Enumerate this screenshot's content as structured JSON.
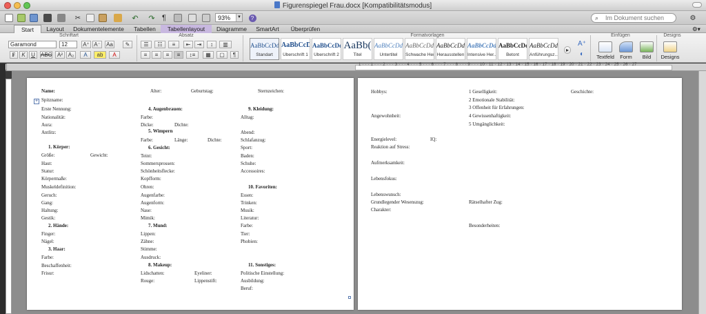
{
  "window": {
    "title": "Figurenspiegel Frau.docx [Kompatibilitätsmodus]"
  },
  "toolbar": {
    "zoom": "93%",
    "search_placeholder": "Im Dokument suchen",
    "paragraph_mark": "¶"
  },
  "tabs": [
    "Start",
    "Layout",
    "Dokumentelemente",
    "Tabellen",
    "Tabellenlayout",
    "Diagramme",
    "SmartArt",
    "Überprüfen"
  ],
  "ribbon": {
    "groups": {
      "schriftart": "Schriftart",
      "absatz": "Absatz",
      "formatvorlagen": "Formatvorlagen",
      "einfuegen": "Einfügen",
      "designs": "Designs"
    },
    "font_name": "Garamond",
    "font_size": "12",
    "styles": [
      {
        "preview": "AaBbCcDdE",
        "name": "Standart"
      },
      {
        "preview": "AaBbCcD",
        "name": "Überschrift 1"
      },
      {
        "preview": "AaBbCcDdI",
        "name": "Überschrift 2"
      },
      {
        "preview": "AaBb(",
        "name": "Titel"
      },
      {
        "preview": "AaBbCcDdE",
        "name": "Untertitel"
      },
      {
        "preview": "AaBbCcDdE",
        "name": "Schwache Her..."
      },
      {
        "preview": "AaBbCcDdEe",
        "name": "Herausstellen"
      },
      {
        "preview": "AaBbCcDdEe",
        "name": "Intensive Her..."
      },
      {
        "preview": "AaBbCcDdEe",
        "name": "Betont"
      },
      {
        "preview": "AaBbCcDdEe",
        "name": "Anführungsz..."
      }
    ],
    "insert_buttons": [
      "Textfeld",
      "Form",
      "Bild"
    ],
    "designs_button": "Designs"
  },
  "ruler": {
    "labels": "1 · · · 1 · · · 2 · · · 3 · · · 4 · · · 5 · · · 6 · · · 7 · · · 8 · · · 9 · · · 10 · 11 · 12 · 13 · 14 · 15 · 16 · 17 · 18 · 19 · 20 · 21 · 22 · 23 · 24 · 25 · 26 · 27"
  },
  "page1": {
    "col1": {
      "name": "Name:",
      "spitzname": "Spitzname:",
      "erste_nennung": "Erste Nennung:",
      "nationalitaet": "Nationalität:",
      "aura": "Aura:",
      "antlitz": "Antlitz:",
      "h1": "1.   Körper:",
      "groesse": "Größe:",
      "gewicht": "Gewicht:",
      "haut": "Haut:",
      "statur": "Statur:",
      "koerpermasse": "Körpermaße:",
      "muskel": "Muskeldefinition:",
      "geruch": "Geruch:",
      "gang": "Gang:",
      "haltung": "Haltung:",
      "gestik": "Gestik:",
      "h2": "2.   Hände:",
      "finger": "Finger:",
      "naegel": "Nägel:",
      "h3": "3.   Haar:",
      "farbe": "Farbe:",
      "beschaffenheit": "Beschaffenheit:",
      "frisur": "Frisur:"
    },
    "col2": {
      "alter": "Alter:",
      "geburtstag": "Geburtstag:",
      "h4": "4.   Augenbrauen:",
      "farbe": "Farbe:",
      "dicke": "Dicke:",
      "dichte": "Dichte:",
      "h5": "5.   Wimpern",
      "farbe2": "Farbe:",
      "laenge": "Länge:",
      "dichte2": "Dichte:",
      "h6": "6.   Gesicht:",
      "teint": "Teint:",
      "sommersprossen": "Sommersprossen:",
      "schoenheitsflecke": "Schönheitsflecke:",
      "kopfform": "Kopfform:",
      "ohren": "Ohren:",
      "augenfarbe": "Augenfarbe:",
      "augenform": "Augenform:",
      "nase": "Nase:",
      "mimik": "Mimik:",
      "h7": "7.   Mund:",
      "lippen": "Lippen:",
      "zaehne": "Zähne:",
      "stimme": "Stimme:",
      "ausdruck": "Ausdruck:",
      "h8": "8.   Makeup:",
      "lidschatten": "Lidschatten:",
      "eyeliner": "Eyeliner:",
      "rouge": "Rouge:",
      "lippenstift": "Lippenstift:"
    },
    "col3": {
      "sternzeichen": "Sternzeichen:",
      "h9": "9.   Kleidung:",
      "alltag": "Alltag:",
      "abend": "Abend:",
      "schlafanzug": "Schlafanzug:",
      "sport": "Sport:",
      "baden": "Baden:",
      "schuhe": "Schuhe:",
      "accessoires": "Accessoires:",
      "h10": "10.  Favoriten:",
      "essen": "Essen:",
      "trinken": "Trinken:",
      "musik": "Musik:",
      "literatur": "Literatur:",
      "farbe": "Farbe:",
      "tier": "Tier:",
      "phobien": "Phobien:",
      "h11": "11.  Sonstiges:",
      "politik": "Politische Einstellung:",
      "ausbildung": "Ausbildung:",
      "beruf": "Beruf:"
    }
  },
  "page2": {
    "hobbys": "Hobbys:",
    "eig1": "1 Geselligkeit:",
    "eig2": "2 Emotionale Stabilität:",
    "eig3": "3 Offenheit für Erfahrungen:",
    "eig4": "4 Gewissenhaftigkeit:",
    "eig5": "5 Umgänglichkeit:",
    "geschichte": "Geschichte:",
    "angewohnheit": "Angewohnheit:",
    "energielevel": "Energielevel:",
    "iq": "IQ:",
    "reaktion": "Reaktion auf Stress:",
    "aufmerksamkeit": "Aufmerksamkeit:",
    "lebensfokus": "Lebensfokus:",
    "lebenswunsch": "Lebenswunsch:",
    "wesenszug": "Grundlegender Wesenszug:",
    "raetsel": "Rätselhafter Zug:",
    "charakter": "Charakter:",
    "besonderheiten": "Besonderheiten:"
  },
  "colors": {
    "tab_context": "#c8b8e0",
    "accent": "#1f4e8c",
    "close": "#ee5f57",
    "minimize": "#f5bd4f",
    "zoom": "#62c655"
  }
}
